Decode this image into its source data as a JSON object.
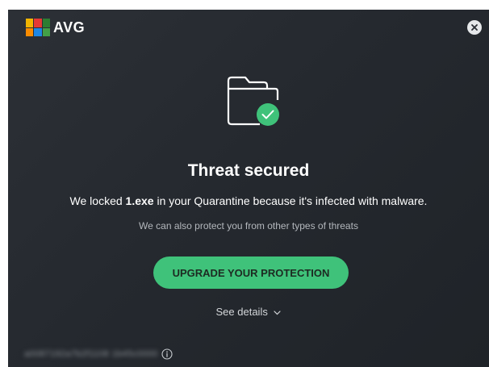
{
  "app": {
    "name": "AVG",
    "logo_colors": [
      "#f2b500",
      "#e53935",
      "#2e7d32",
      "#1e88e5",
      "#fb8c00",
      "#43a047"
    ]
  },
  "window": {
    "close_icon": "close-icon"
  },
  "alert": {
    "icon": "folder-check-icon",
    "title": "Threat secured",
    "message_prefix": "We locked ",
    "file_name": "1.exe",
    "message_suffix": " in your Quarantine because it's infected with malware.",
    "subtext": "We can also protect you from other types of threats"
  },
  "actions": {
    "upgrade_label": "UPGRADE YOUR PROTECTION",
    "details_label": "See details",
    "details_icon": "chevron-down-icon"
  },
  "footer": {
    "id_text": "a0087192a7b2f1108 1b45c0000",
    "info_icon": "info-icon"
  },
  "colors": {
    "background": "#2a2e34",
    "accent_green": "#3fc27a",
    "text_primary": "#ffffff",
    "text_secondary": "#b4b8bd"
  }
}
